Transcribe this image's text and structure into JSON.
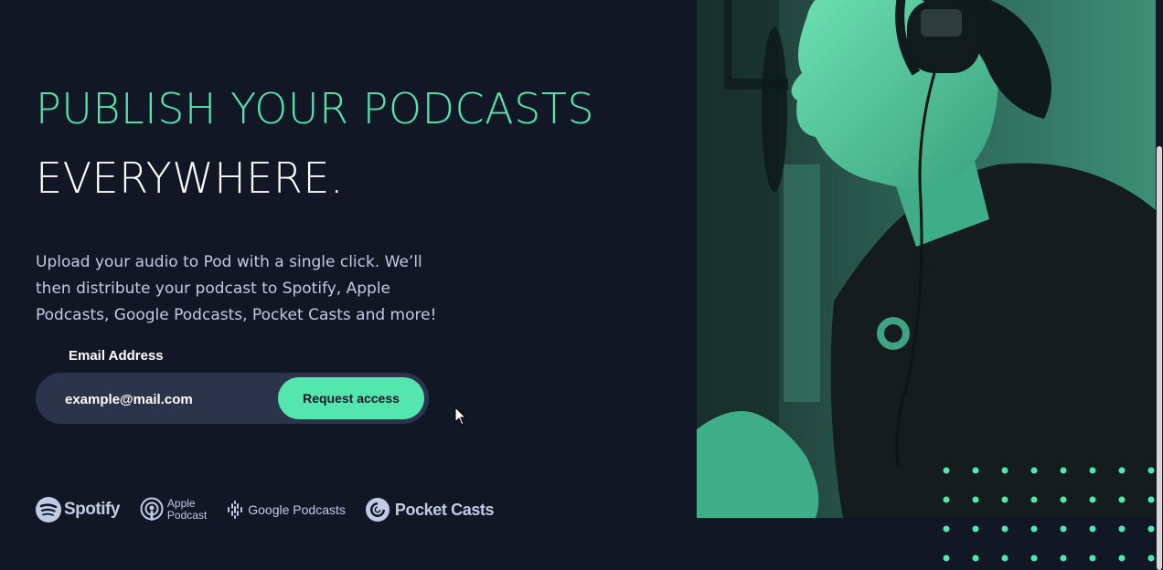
{
  "hero": {
    "title_line1": "PUBLISH YOUR PODCASTS",
    "title_line2": "EVERYWHERE.",
    "description": "Upload your audio to Pod with a single click. We’ll then distribute your podcast to Spotify, Apple Podcasts, Google Podcasts, Pocket Casts and more!"
  },
  "form": {
    "email_label": "Email Address",
    "email_value": "example@mail.com",
    "submit_label": "Request access"
  },
  "platforms": {
    "spotify": "Spotify",
    "apple_line1": "Apple",
    "apple_line2": "Podcast",
    "google": "Google Podcasts",
    "pocket": "Pocket Casts"
  },
  "colors": {
    "accent": "#54e6af",
    "background": "#121725",
    "input_bg": "#2c344b",
    "body_text": "#c2cbe5"
  }
}
